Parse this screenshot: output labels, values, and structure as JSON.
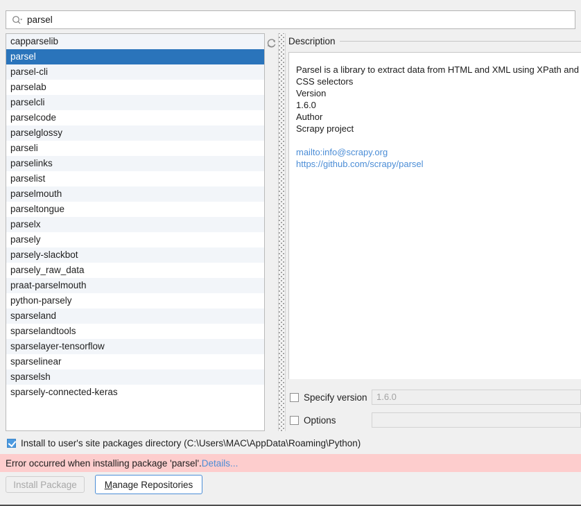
{
  "search": {
    "value": "parsel",
    "placeholder": "",
    "icon": "search-icon"
  },
  "packages": {
    "refresh_icon": "refresh-icon",
    "selected": "parsel",
    "items": [
      "capparselib",
      "parsel",
      "parsel-cli",
      "parselab",
      "parselcli",
      "parselcode",
      "parselglossy",
      "parseli",
      "parselinks",
      "parselist",
      "parselmouth",
      "parseltongue",
      "parselx",
      "parsely",
      "parsely-slackbot",
      "parsely_raw_data",
      "praat-parselmouth",
      "python-parsely",
      "sparseland",
      "sparselandtools",
      "sparselayer-tensorflow",
      "sparselinear",
      "sparselsh",
      "sparsely-connected-keras"
    ]
  },
  "description": {
    "legend": "Description",
    "summary": "Parsel is a library to extract data from HTML and XML using XPath and CSS selectors",
    "version_label": "Version",
    "version_value": "1.6.0",
    "author_label": "Author",
    "author_value": "Scrapy project",
    "links": [
      "mailto:info@scrapy.org",
      "https://github.com/scrapy/parsel"
    ]
  },
  "options_panel": {
    "specify_version_label": "Specify version",
    "specify_version_checked": false,
    "specify_version_value": "1.6.0",
    "options_label": "Options",
    "options_checked": false,
    "options_value": ""
  },
  "user_dir": {
    "checked": true,
    "label": "Install to user's site packages directory (C:\\Users\\MAC\\AppData\\Roaming\\Python)"
  },
  "error": {
    "message": "Error occurred when installing package 'parsel'.",
    "link": "Details...",
    "bg_color": "#fdcdcd",
    "link_color": "#4b8dd6"
  },
  "buttons": {
    "install_label": "Install Package",
    "install_enabled": false,
    "manage_label_mnemonic": "M",
    "manage_label_rest": "anage Repositories"
  },
  "colors": {
    "selection_blue": "#2a74bb",
    "panel_bg": "#f0f0f0",
    "row_alt": "#f2f5f9",
    "link_blue": "#4b8dd6"
  }
}
